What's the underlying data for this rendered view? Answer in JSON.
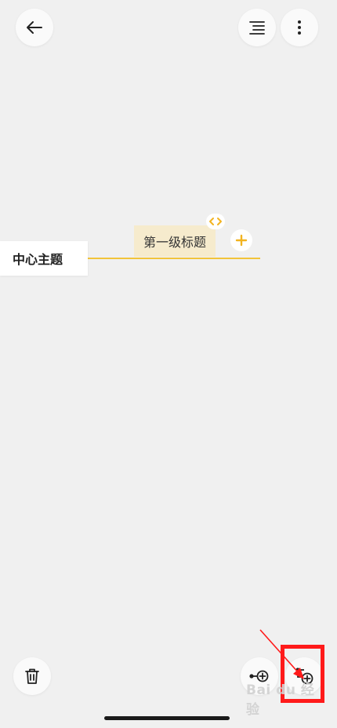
{
  "toolbar_top": {
    "back_icon": "arrow-left-icon",
    "outline_icon": "outline-list-icon",
    "more_icon": "more-vertical-icon"
  },
  "mindmap": {
    "central_topic": "中心主题",
    "subtopic": "第一级标题",
    "collapse_icon": "expand-collapse-chevrons-icon",
    "add_icon": "plus-icon"
  },
  "toolbar_bottom": {
    "delete_icon": "trash-icon",
    "add_sibling_icon": "add-sibling-node-icon",
    "add_child_icon": "add-child-node-icon"
  },
  "watermark": {
    "text": "Bai du 经验"
  },
  "colors": {
    "accent": "#f2c43a",
    "subtopic_fill": "#f6ebcd",
    "annotation": "#ff1a1a"
  }
}
